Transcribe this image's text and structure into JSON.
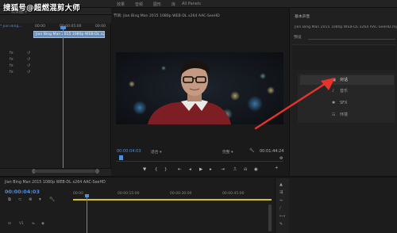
{
  "watermark": {
    "text": "搜狐号@超燃混剪大师"
  },
  "workspace_tabs": [
    {
      "label": "效果"
    },
    {
      "label": "音频"
    },
    {
      "label": "图形"
    },
    {
      "label": "库"
    },
    {
      "label": "All Panels"
    }
  ],
  "left_panel": {
    "header": "效果控件",
    "source_clip_tab": "* Jian Bing...",
    "sequence_label": "Jian Bing...",
    "ruler_start": "00:00",
    "ruler_mid": "00:00:05:00",
    "ruler_end": "00:00",
    "clip_name": "Jian Bing Man 2015 1080p WEB-DL x264 AAC-SeeHD",
    "control_icons": [
      "fx",
      "fx",
      "fx",
      "fx"
    ]
  },
  "monitor": {
    "title": "节目: Jian Bing Man 2015 1080p WEB-DL x264 AAC-SeeHD",
    "timecode_current": "00:00:04:03",
    "fit_label": "适合",
    "quality_label": "完整",
    "timecode_duration": "00:01:44:24",
    "transport_buttons": [
      {
        "icon": "marker-icon",
        "glyph": "▼"
      },
      {
        "icon": "mark-in-icon",
        "glyph": "{"
      },
      {
        "icon": "mark-out-icon",
        "glyph": "}"
      },
      {
        "icon": "go-to-in-icon",
        "glyph": "⇤"
      },
      {
        "icon": "step-back-icon",
        "glyph": "◂"
      },
      {
        "icon": "play-icon",
        "glyph": "▶"
      },
      {
        "icon": "step-forward-icon",
        "glyph": "▸"
      },
      {
        "icon": "go-to-out-icon",
        "glyph": "⇥"
      },
      {
        "icon": "lift-icon",
        "glyph": "⎍"
      },
      {
        "icon": "extract-icon",
        "glyph": "⎌"
      },
      {
        "icon": "export-frame-icon",
        "glyph": "◉"
      }
    ],
    "add_button": "+",
    "settings_icon": "⚙"
  },
  "effects_panel": {
    "header": "基本声音",
    "clip": "Jian Bing Man 2015 1080p WEB-DL x264 AAC-SeeHD.mp4",
    "master_label": "预设",
    "items": [
      {
        "label": "对话",
        "icon": "speech-icon",
        "glyph": "▣",
        "selected": true
      },
      {
        "label": "音乐",
        "icon": "music-icon",
        "glyph": "♪",
        "selected": false
      },
      {
        "label": "SFX",
        "icon": "sfx-icon",
        "glyph": "✱",
        "selected": false
      },
      {
        "label": "环境",
        "icon": "ambience-icon",
        "glyph": "☷",
        "selected": false
      }
    ]
  },
  "timeline": {
    "title": "Jian Bing Man 2015 1080p WEB-DL x264 AAC-SeeHD",
    "timecode": "00:00:04:03",
    "ruler_labels": [
      "00:00",
      "00:00:15:00",
      "00:00:30:00",
      "00:00:45:00"
    ],
    "track_label": "V1"
  },
  "colors": {
    "accent_blue": "#4a8fe0",
    "arrow_red": "#e8322c",
    "work_area_yellow": "#d8c22a"
  }
}
